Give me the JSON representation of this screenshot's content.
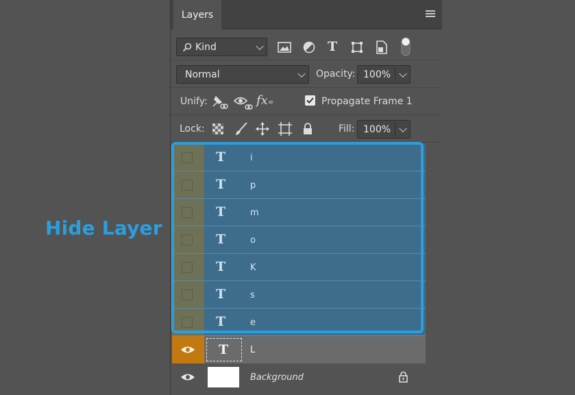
{
  "annotation": {
    "text": "Hide Layer"
  },
  "panel": {
    "tab_label": "Layers",
    "filter": {
      "kind_label": "Kind"
    },
    "blend": {
      "mode": "Normal",
      "opacity_label": "Opacity:",
      "opacity_value": "100%"
    },
    "unify": {
      "label": "Unify:",
      "propagate_label": "Propagate Frame 1",
      "propagate_checked": true
    },
    "lock": {
      "label": "Lock:",
      "fill_label": "Fill:",
      "fill_value": "100%"
    },
    "layers": [
      {
        "name": "i",
        "type": "text",
        "visible": false,
        "selected": true
      },
      {
        "name": "p",
        "type": "text",
        "visible": false,
        "selected": true
      },
      {
        "name": "m",
        "type": "text",
        "visible": false,
        "selected": true
      },
      {
        "name": "o",
        "type": "text",
        "visible": false,
        "selected": true
      },
      {
        "name": "K",
        "type": "text",
        "visible": false,
        "selected": true
      },
      {
        "name": "s",
        "type": "text",
        "visible": false,
        "selected": true
      },
      {
        "name": "e",
        "type": "text",
        "visible": false,
        "selected": true
      },
      {
        "name": "L",
        "type": "text",
        "visible": true,
        "selected": false
      },
      {
        "name": "Background",
        "type": "image",
        "visible": true,
        "selected": false,
        "locked": true
      }
    ]
  },
  "colors": {
    "accent": "#2b9ede",
    "selection": "#3d6c8c",
    "visibility_active": "#c27a10"
  }
}
